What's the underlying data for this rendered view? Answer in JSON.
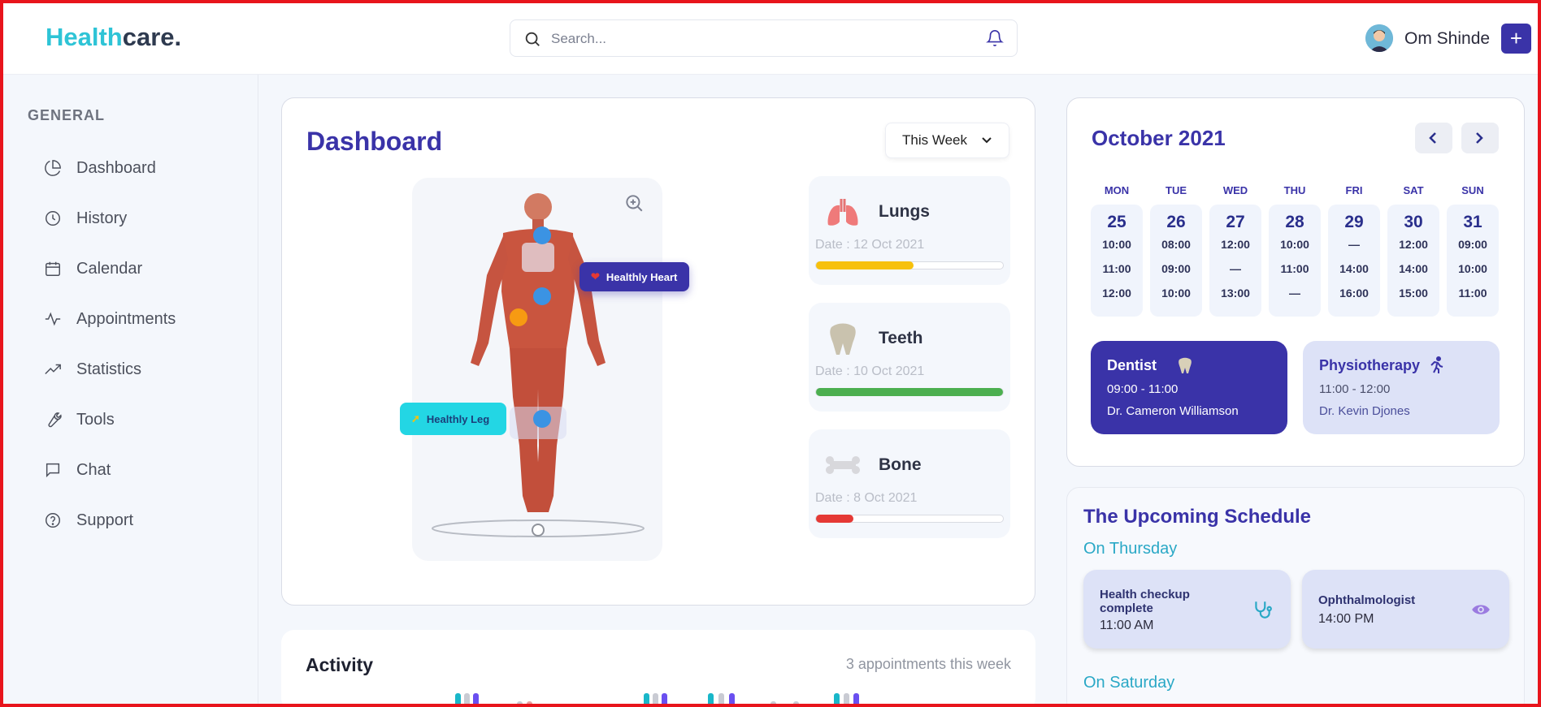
{
  "header": {
    "logo_part1": "Health",
    "logo_part2": "care.",
    "search_placeholder": "Search...",
    "user_name": "Om Shinde",
    "add_label": "+"
  },
  "sidebar": {
    "section": "GENERAL",
    "items": [
      {
        "label": "Dashboard",
        "icon": "pie-chart-icon"
      },
      {
        "label": "History",
        "icon": "clock-icon"
      },
      {
        "label": "Calendar",
        "icon": "calendar-icon"
      },
      {
        "label": "Appointments",
        "icon": "activity-icon"
      },
      {
        "label": "Statistics",
        "icon": "trending-up-icon"
      },
      {
        "label": "Tools",
        "icon": "wrench-icon"
      },
      {
        "label": "Chat",
        "icon": "message-icon"
      },
      {
        "label": "Support",
        "icon": "help-circle-icon"
      }
    ]
  },
  "dashboard": {
    "title": "Dashboard",
    "period": "This Week",
    "heart_tag": "Healthly Heart",
    "leg_tag": "Healthly Leg",
    "organs": [
      {
        "name": "Lungs",
        "date": "Date : 12 Oct 2021",
        "progress": 0.52,
        "color": "#f7c10c"
      },
      {
        "name": "Teeth",
        "date": "Date : 10 Oct 2021",
        "progress": 1.0,
        "color": "#4caf50"
      },
      {
        "name": "Bone",
        "date": "Date : 8 Oct 2021",
        "progress": 0.2,
        "color": "#e53935"
      }
    ]
  },
  "activity": {
    "title": "Activity",
    "count": "3 appointments this week"
  },
  "calendar": {
    "title": "October 2021",
    "days": [
      {
        "name": "MON",
        "num": "25",
        "times": [
          "10:00",
          "11:00",
          "12:00"
        ]
      },
      {
        "name": "TUE",
        "num": "26",
        "times": [
          "08:00",
          "09:00",
          "10:00"
        ]
      },
      {
        "name": "WED",
        "num": "27",
        "times": [
          "12:00",
          "—",
          "13:00"
        ]
      },
      {
        "name": "THU",
        "num": "28",
        "times": [
          "10:00",
          "11:00",
          "—"
        ]
      },
      {
        "name": "FRI",
        "num": "29",
        "times": [
          "—",
          "14:00",
          "16:00"
        ]
      },
      {
        "name": "SAT",
        "num": "30",
        "times": [
          "12:00",
          "14:00",
          "15:00"
        ]
      },
      {
        "name": "SUN",
        "num": "31",
        "times": [
          "09:00",
          "10:00",
          "11:00"
        ]
      }
    ],
    "appointments": [
      {
        "title": "Dentist",
        "time": "09:00 - 11:00",
        "doctor": "Dr. Cameron Williamson"
      },
      {
        "title": "Physiotherapy",
        "time": "11:00 - 12:00",
        "doctor": "Dr. Kevin Djones"
      }
    ]
  },
  "schedule": {
    "title": "The Upcoming Schedule",
    "day1": "On Thursday",
    "day2": "On Saturday",
    "items": [
      {
        "title": "Health checkup complete",
        "time": "11:00 AM"
      },
      {
        "title": "Ophthalmologist",
        "time": "14:00 PM"
      }
    ]
  },
  "colors": {
    "brand": "#3a33a8",
    "accent": "#2ec4d6"
  }
}
